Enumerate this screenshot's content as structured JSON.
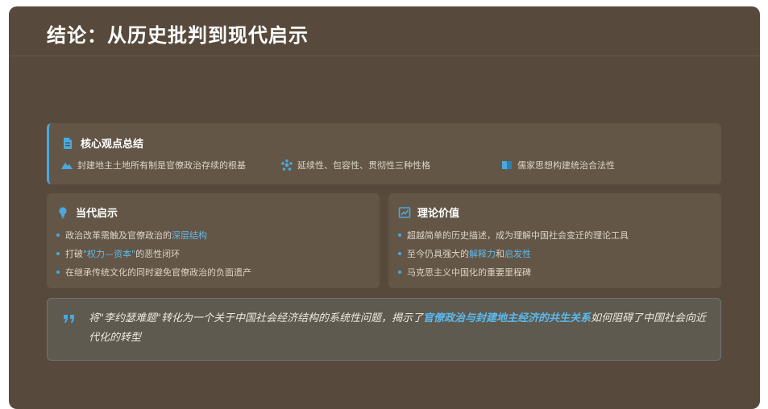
{
  "title": "结论：从历史批判到现代启示",
  "core": {
    "icon": "document-icon",
    "title": "核心观点总结",
    "items": [
      {
        "icon": "mountain-icon",
        "text": "封建地主土地所有制是官僚政治存续的根基"
      },
      {
        "icon": "nodes-icon",
        "text": "延续性、包容性、贯彻性三种性格"
      },
      {
        "icon": "book-icon",
        "text": "儒家思想构建统治合法性"
      }
    ]
  },
  "contemporary": {
    "icon": "lightbulb-icon",
    "title": "当代启示",
    "items": [
      {
        "before": "政治改革需触及官僚政治的",
        "highlight": "深层结构",
        "after": ""
      },
      {
        "before": "打破",
        "highlight": "\"权力—资本\"",
        "after": "的恶性闭环"
      },
      {
        "before": "在继承传统文化的同时避免官僚政治的负面遗产",
        "highlight": "",
        "after": ""
      }
    ]
  },
  "theory": {
    "icon": "chart-icon",
    "title": "理论价值",
    "items": [
      {
        "a": "超越简单的历史描述，成为理解中国社会变迁的理论工具",
        "h1": "",
        "b": "",
        "h2": ""
      },
      {
        "a": "至今仍具强大的",
        "h1": "解释力",
        "b": "和",
        "h2": "启发性"
      },
      {
        "a": "马克思主义中国化的重要里程碑",
        "h1": "",
        "b": "",
        "h2": ""
      }
    ]
  },
  "quote": {
    "icon": "quote-icon",
    "before": "将\"李约瑟难题\"转化为一个关于中国社会经济结构的系统性问题，揭示了",
    "highlight": "官僚政治与封建地主经济的共生关系",
    "after": "如何阻碍了中国社会向近代化的转型"
  },
  "colors": {
    "background": "#574a3c",
    "accent": "#4aa8df",
    "card": "#635647"
  }
}
